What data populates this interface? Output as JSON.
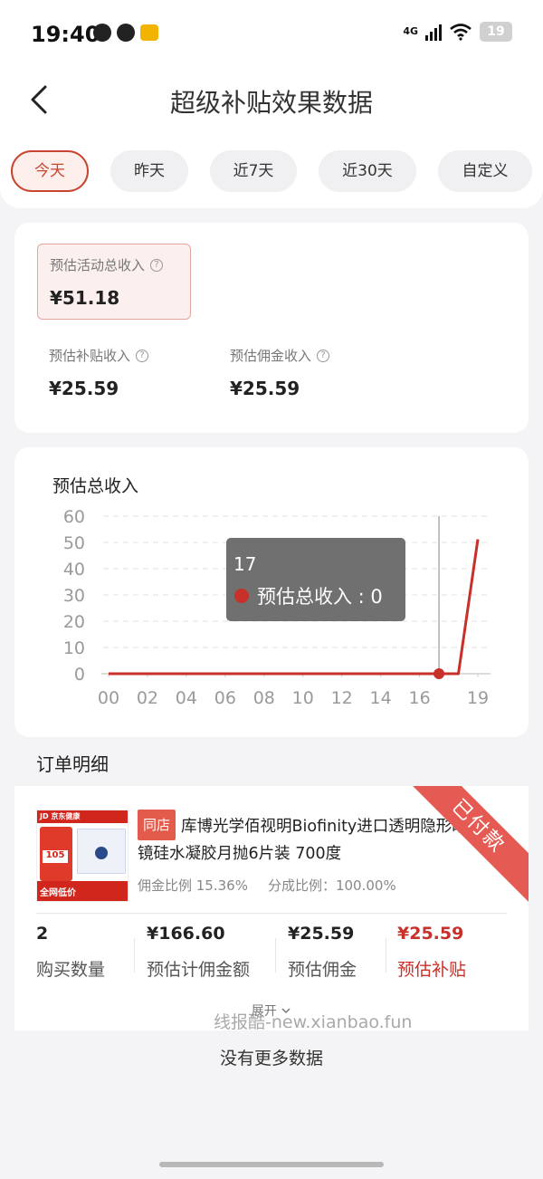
{
  "status": {
    "time": "19:40",
    "network": "4G",
    "battery": "19"
  },
  "header": {
    "title": "超级补贴效果数据"
  },
  "tabs": [
    {
      "label": "今天",
      "active": true
    },
    {
      "label": "昨天",
      "active": false
    },
    {
      "label": "近7天",
      "active": false
    },
    {
      "label": "近30天",
      "active": false
    },
    {
      "label": "自定义",
      "active": false
    }
  ],
  "summary": {
    "total_label": "预估活动总收入",
    "total_value": "¥51.18",
    "subsidy_label": "预估补贴收入",
    "subsidy_value": "¥25.59",
    "commission_label": "预估佣金收入",
    "commission_value": "¥25.59",
    "help_glyph": "?"
  },
  "chart_data": {
    "type": "line",
    "title": "预估总收入",
    "series": [
      {
        "name": "预估总收入",
        "color": "#c8312a",
        "x": [
          0,
          1,
          2,
          3,
          4,
          5,
          6,
          7,
          8,
          9,
          10,
          11,
          12,
          13,
          14,
          15,
          16,
          17,
          18,
          19
        ],
        "values": [
          0,
          0,
          0,
          0,
          0,
          0,
          0,
          0,
          0,
          0,
          0,
          0,
          0,
          0,
          0,
          0,
          0,
          0,
          0,
          51.18
        ]
      }
    ],
    "x_ticks": [
      "00",
      "02",
      "04",
      "06",
      "08",
      "10",
      "12",
      "14",
      "16",
      "19"
    ],
    "y_ticks": [
      0,
      10,
      20,
      30,
      40,
      50,
      60
    ],
    "ylim": [
      0,
      60
    ],
    "grid": true,
    "tooltip": {
      "x_label": "17",
      "series_label": "预估总收入",
      "separator": " : ",
      "value": "0",
      "x": 17
    }
  },
  "orders": {
    "section_title": "订单明细",
    "item": {
      "shop_tag": "同店",
      "title": "库博光学佰视明Biofinity进口透明隐形眼镜硅水凝胶月抛6片装 700度",
      "commission_ratio": "佣金比例 15.36%",
      "share_ratio": "分成比例：100.00%",
      "status_ribbon": "已付款",
      "image_texts": {
        "brand": "JD 京东健康",
        "price": "105",
        "bottom": "全网低价"
      },
      "stats": [
        {
          "value": "2",
          "label": "购买数量"
        },
        {
          "value": "¥166.60",
          "label": "预估计佣金额"
        },
        {
          "value": "¥25.59",
          "label": "预估佣金"
        },
        {
          "value": "¥25.59",
          "label": "预估补贴"
        }
      ],
      "expand_label": "展开"
    }
  },
  "watermark": "线报酷-new.xianbao.fun",
  "footer": {
    "no_more": "没有更多数据"
  }
}
